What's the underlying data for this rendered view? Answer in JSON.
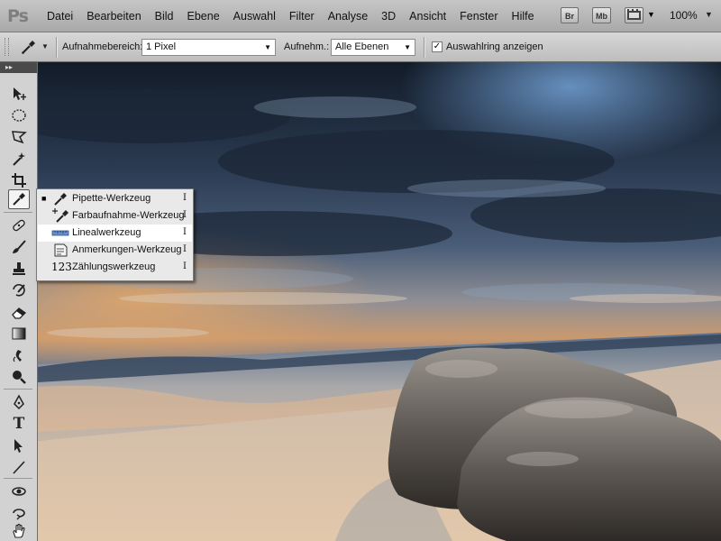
{
  "menubar": {
    "logo": "Ps",
    "items": [
      "Datei",
      "Bearbeiten",
      "Bild",
      "Ebene",
      "Auswahl",
      "Filter",
      "Analyse",
      "3D",
      "Ansicht",
      "Fenster",
      "Hilfe"
    ],
    "bridge_label": "Br",
    "minibridge_label": "Mb",
    "zoom": "100%"
  },
  "options": {
    "sample_size_label": "Aufnahmebereich:",
    "sample_size_value": "1 Pixel",
    "sample_label": "Aufnehm.:",
    "sample_value": "Alle Ebenen",
    "show_ring_label": "Auswahlring anzeigen",
    "show_ring_checked": true
  },
  "toolbar": {
    "collapse_glyph": "▸▸",
    "type_tool_glyph": "T"
  },
  "flyout": {
    "items": [
      {
        "label": "Pipette-Werkzeug",
        "key": "I",
        "selected": true,
        "icon": "eyedropper-icon"
      },
      {
        "label": "Farbaufnahme-Werkzeug",
        "key": "I",
        "selected": false,
        "icon": "color-sampler-icon"
      },
      {
        "label": "Linealwerkzeug",
        "key": "I",
        "selected": false,
        "icon": "ruler-icon"
      },
      {
        "label": "Anmerkungen-Werkzeug",
        "key": "I",
        "selected": false,
        "icon": "note-icon"
      },
      {
        "label": "Zählungswerkzeug",
        "key": "I",
        "selected": false,
        "icon": "count-icon"
      }
    ],
    "selected_bullet": "■",
    "count_icon_text": "123"
  },
  "colors": {
    "menubar": "#b8b8b8",
    "toolbar": "#d2d2d2",
    "highlight": "#ffffff",
    "sky_dark": "#1d2a3b",
    "sand": "#d9c2a8"
  }
}
